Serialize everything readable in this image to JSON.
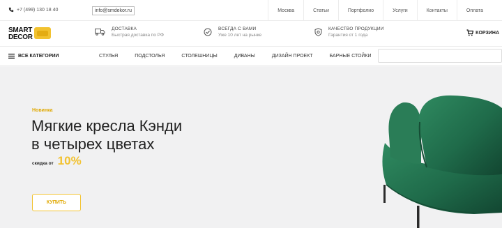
{
  "topbar": {
    "phone": "+7 (499) 130 18 40",
    "email": "info@smdekor.ru",
    "links": [
      "Москва",
      "Статьи",
      "Портфолио",
      "Услуги",
      "Контакты",
      "Оплата"
    ]
  },
  "header": {
    "logo_line1": "SMART",
    "logo_line2": "DECOR",
    "features": [
      {
        "icon": "truck-icon",
        "title": "ДОСТАВКА",
        "subtitle": "Быстрая доставка по РФ"
      },
      {
        "icon": "check-circle-icon",
        "title": "ВСЕГДА С ВАМИ",
        "subtitle": "Уже 10 лет на рынке"
      },
      {
        "icon": "shield-icon",
        "title": "КАЧЕСТВО ПРОДУКЦИИ",
        "subtitle": "Гарантия от 1 года"
      }
    ],
    "cart_label": "КОРЗИНА"
  },
  "nav": {
    "all_categories": "ВСЕ КАТЕГОРИИ",
    "items": [
      "СТУЛЬЯ",
      "ПОДСТОЛЬЯ",
      "СТОЛЕШНИЦЫ",
      "ДИВАНЫ",
      "ДИЗАЙН ПРОЕКТ",
      "БАРНЫЕ СТОЙКИ"
    ],
    "search_placeholder": ""
  },
  "hero": {
    "badge": "Новинка",
    "title_line1": "Мягкие кресла Кэнди",
    "title_line2": "в четырех цветах",
    "discount_label": "скидка от",
    "discount_value": "10%",
    "button_label": "КУПИТЬ"
  },
  "colors": {
    "accent": "#f2c230",
    "hero_bg": "#f1f1f2",
    "armchair": "#1f6b4a"
  }
}
